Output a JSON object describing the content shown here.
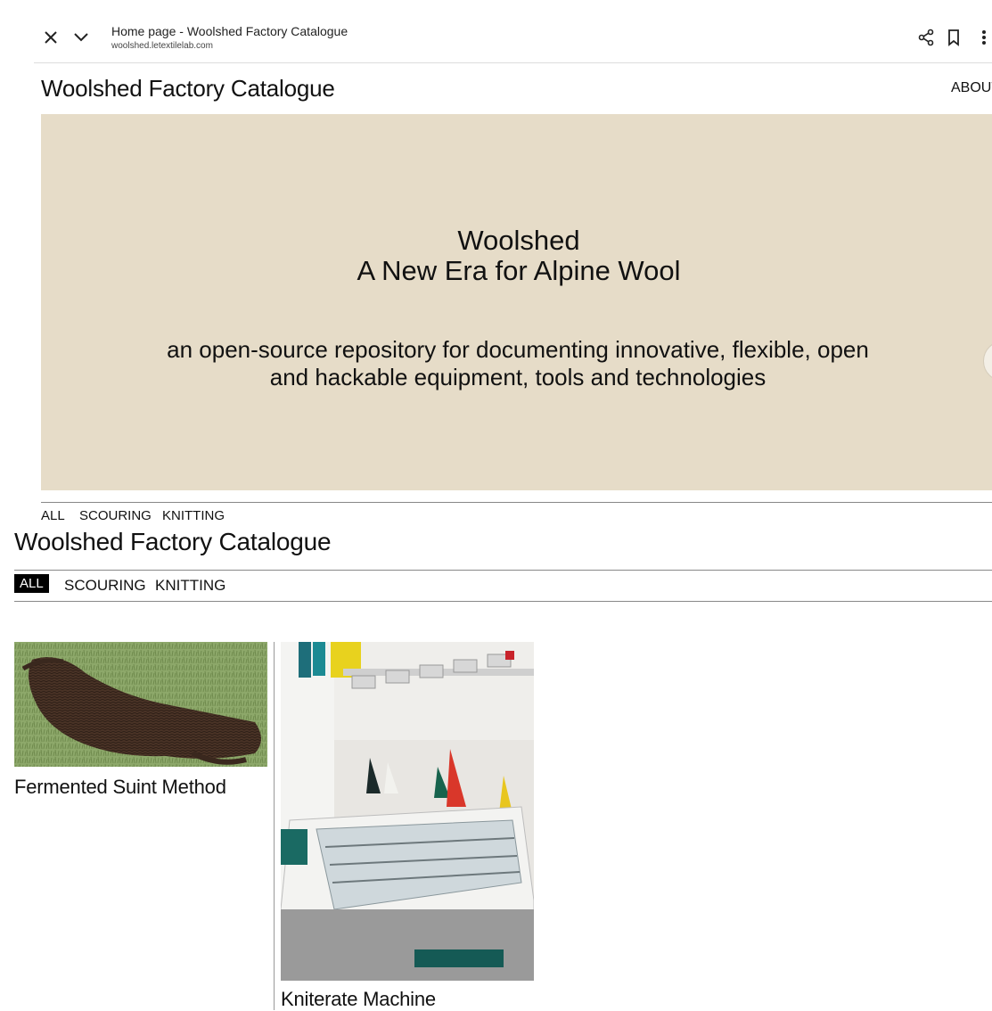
{
  "browser": {
    "page_title": "Home page - Woolshed Factory Catalogue",
    "url": "woolshed.letextilelab.com",
    "icons": [
      "close-icon",
      "chevron-down-icon",
      "share-icon",
      "bookmark-icon",
      "more-vert-icon"
    ]
  },
  "header": {
    "site_title": "Woolshed Factory Catalogue",
    "about": "ABOUT"
  },
  "hero": {
    "line1": "Woolshed",
    "line2": "A New Era for Alpine Wool",
    "description": "an open-source repository for documenting innovative, flexible, open and hackable equipment, tools and technologies",
    "bg_color": "#e6dcc8"
  },
  "filters_top": [
    "ALL",
    "SCOURING",
    "KNITTING"
  ],
  "catalogue": {
    "title": "Woolshed Factory Catalogue",
    "filters": [
      "ALL",
      "SCOURING",
      "KNITTING"
    ],
    "active_filter": "ALL"
  },
  "cards": [
    {
      "title": "Fermented Suint Method",
      "image": "dark-brown-raw-fleece-on-grass"
    },
    {
      "title": "Kniterate Machine",
      "image": "flat-knitting-machine-with-yarn-cones"
    }
  ]
}
